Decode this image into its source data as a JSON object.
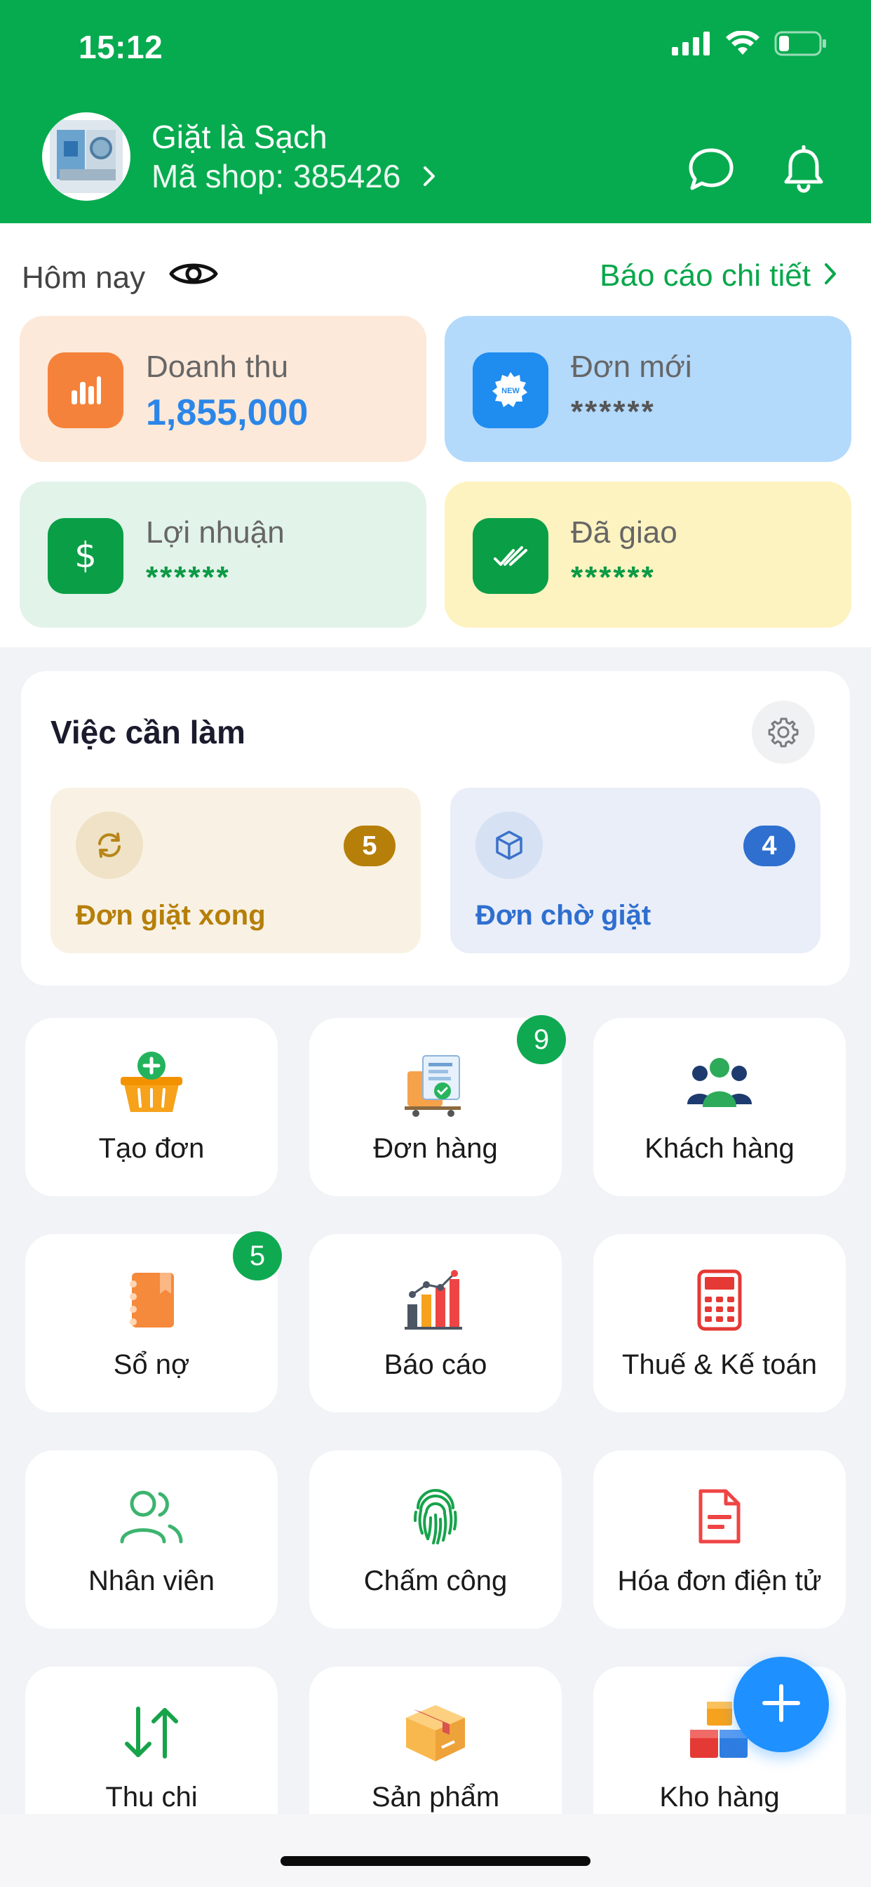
{
  "status_bar": {
    "time": "15:12"
  },
  "header": {
    "shop_name": "Giặt là Sạch",
    "shop_code": "Mã shop: 385426"
  },
  "today": {
    "label": "Hôm nay",
    "report_link": "Báo cáo chi tiết",
    "stats": {
      "revenue": {
        "label": "Doanh thu",
        "value": "1,855,000"
      },
      "new_orders": {
        "label": "Đơn mới",
        "value": "******"
      },
      "profit": {
        "label": "Lợi nhuận",
        "value": "******"
      },
      "delivered": {
        "label": "Đã giao",
        "value": "******"
      }
    }
  },
  "todo": {
    "title": "Việc cần làm",
    "items": [
      {
        "label": "Đơn giặt xong",
        "count": "5"
      },
      {
        "label": "Đơn chờ giặt",
        "count": "4"
      }
    ]
  },
  "tiles": {
    "create_order": "Tạo đơn",
    "orders": "Đơn hàng",
    "orders_badge": "9",
    "customers": "Khách hàng",
    "debt_book": "Sổ nợ",
    "debt_badge": "5",
    "reports": "Báo cáo",
    "tax": "Thuế & Kế toán",
    "staff": "Nhân viên",
    "timekeeping": "Chấm công",
    "einvoice": "Hóa đơn điện tử",
    "cashflow": "Thu chi",
    "products": "Sản phẩm",
    "warehouse": "Kho hàng"
  },
  "colors": {
    "brand_green": "#07ab4f",
    "revenue_blue": "#2b86e8",
    "masked_green": "#0c9a45",
    "fab_blue": "#1e90ff"
  },
  "icons": [
    "signal-icon",
    "wifi-icon",
    "battery-icon",
    "chat-icon",
    "bell-icon",
    "eye-icon",
    "gear-icon",
    "refresh-icon",
    "box-icon",
    "plus-icon"
  ]
}
